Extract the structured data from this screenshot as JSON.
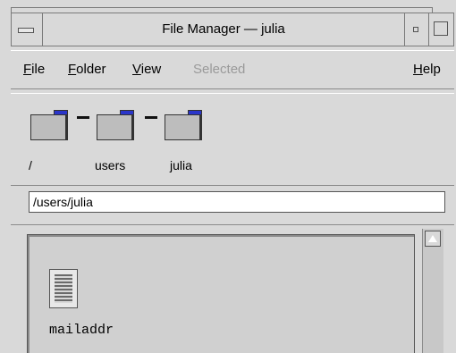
{
  "window": {
    "title": "File Manager — julia"
  },
  "menubar": {
    "items": [
      {
        "mnemonic": "F",
        "rest": "ile"
      },
      {
        "mnemonic": "F",
        "rest": "older"
      },
      {
        "mnemonic": "V",
        "rest": "iew"
      },
      {
        "mnemonic": "",
        "rest": "Selected"
      },
      {
        "mnemonic": "H",
        "rest": "elp"
      }
    ]
  },
  "path": {
    "folders": [
      "/",
      "users",
      "julia"
    ],
    "current_path": "/users/julia"
  },
  "files": [
    {
      "name": "mailaddr",
      "icon": "text-file-icon"
    }
  ],
  "colors": {
    "folder_tab": "#2a35c9",
    "background": "#d9d9d9"
  }
}
